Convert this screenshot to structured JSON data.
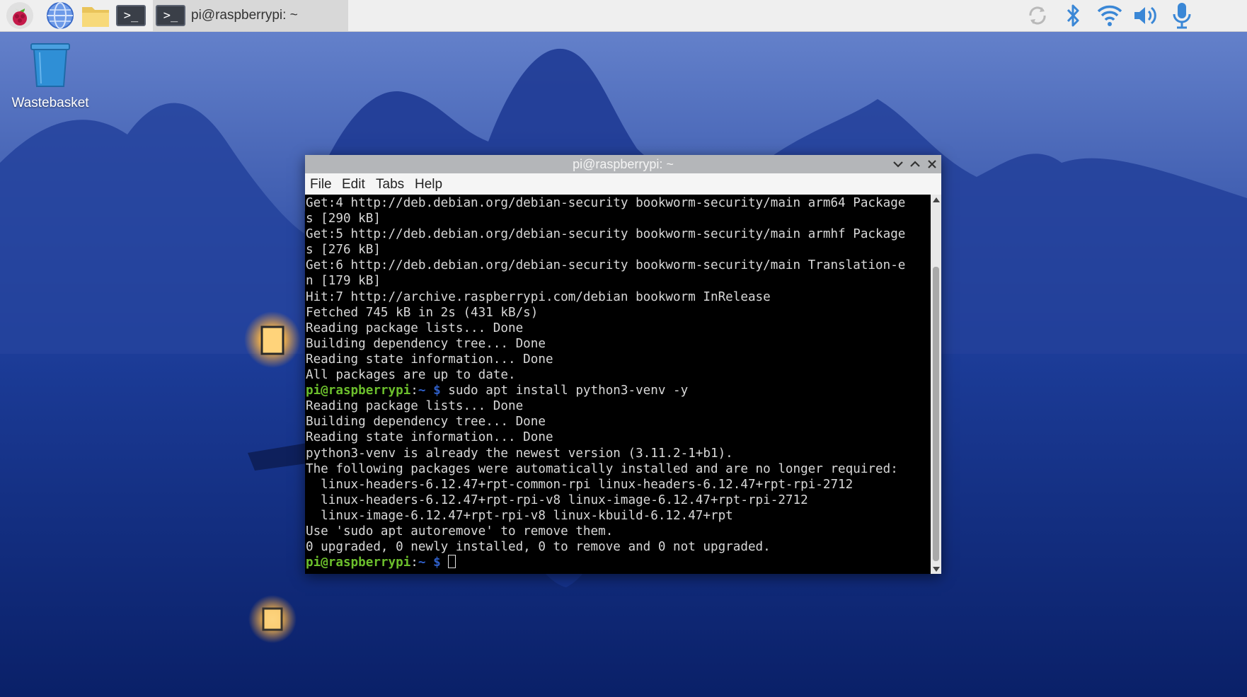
{
  "taskbar": {
    "task_title": "pi@raspberrypi: ~",
    "terminal_glyph": ">_",
    "launchers": [
      "raspberry-menu-icon",
      "web-browser-icon",
      "file-manager-icon",
      "terminal-icon"
    ],
    "tray": [
      "sync-icon",
      "bluetooth-icon",
      "wifi-icon",
      "volume-icon",
      "microphone-icon"
    ]
  },
  "desktop": {
    "icons": [
      {
        "label": "Wastebasket",
        "icon": "trash-icon"
      }
    ]
  },
  "window": {
    "title": "pi@raspberrypi: ~",
    "menu": [
      "File",
      "Edit",
      "Tabs",
      "Help"
    ]
  },
  "terminal": {
    "prompt_user": "pi@raspberrypi",
    "prompt_colon": ":",
    "prompt_path": "~ $",
    "lines": [
      "Get:4 http://deb.debian.org/debian-security bookworm-security/main arm64 Package",
      "s [290 kB]",
      "Get:5 http://deb.debian.org/debian-security bookworm-security/main armhf Package",
      "s [276 kB]",
      "Get:6 http://deb.debian.org/debian-security bookworm-security/main Translation-e",
      "n [179 kB]",
      "Hit:7 http://archive.raspberrypi.com/debian bookworm InRelease",
      "Fetched 745 kB in 2s (431 kB/s)",
      "Reading package lists... Done",
      "Building dependency tree... Done",
      "Reading state information... Done",
      "All packages are up to date.",
      "PROMPT: sudo apt install python3-venv -y",
      "Reading package lists... Done",
      "Building dependency tree... Done",
      "Reading state information... Done",
      "python3-venv is already the newest version (3.11.2-1+b1).",
      "The following packages were automatically installed and are no longer required:",
      "  linux-headers-6.12.47+rpt-common-rpi linux-headers-6.12.47+rpt-rpi-2712",
      "  linux-headers-6.12.47+rpt-rpi-v8 linux-image-6.12.47+rpt-rpi-2712",
      "  linux-image-6.12.47+rpt-rpi-v8 linux-kbuild-6.12.47+rpt",
      "Use 'sudo apt autoremove' to remove them.",
      "0 upgraded, 0 newly installed, 0 to remove and 0 not upgraded.",
      "PROMPT:"
    ]
  },
  "colors": {
    "prompt_user": "#6cbf2c",
    "prompt_path": "#2f5fc8",
    "terminal_bg": "#000000",
    "terminal_fg": "#d8d8d8"
  }
}
